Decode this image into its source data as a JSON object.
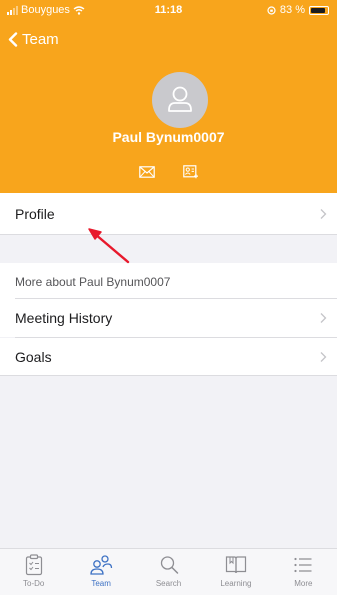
{
  "status": {
    "carrier": "Bouygues",
    "time": "11:18",
    "battery": "83 %"
  },
  "nav": {
    "back_label": "Team"
  },
  "profile": {
    "name": "Paul Bynum0007",
    "actions": [
      "mail-icon",
      "contact-card-icon"
    ]
  },
  "menu": {
    "profile_label": "Profile",
    "section_title": "More about Paul Bynum0007",
    "items": [
      {
        "label": "Meeting History"
      },
      {
        "label": "Goals"
      }
    ]
  },
  "tabs": [
    {
      "label": "To-Do",
      "icon": "clipboard-icon"
    },
    {
      "label": "Team",
      "icon": "team-icon",
      "active": true
    },
    {
      "label": "Search",
      "icon": "search-icon"
    },
    {
      "label": "Learning",
      "icon": "book-icon"
    },
    {
      "label": "More",
      "icon": "list-icon"
    }
  ],
  "colors": {
    "header": "#f8a51c",
    "active_tab": "#3e72c4",
    "annotation_arrow": "#e8192c"
  }
}
